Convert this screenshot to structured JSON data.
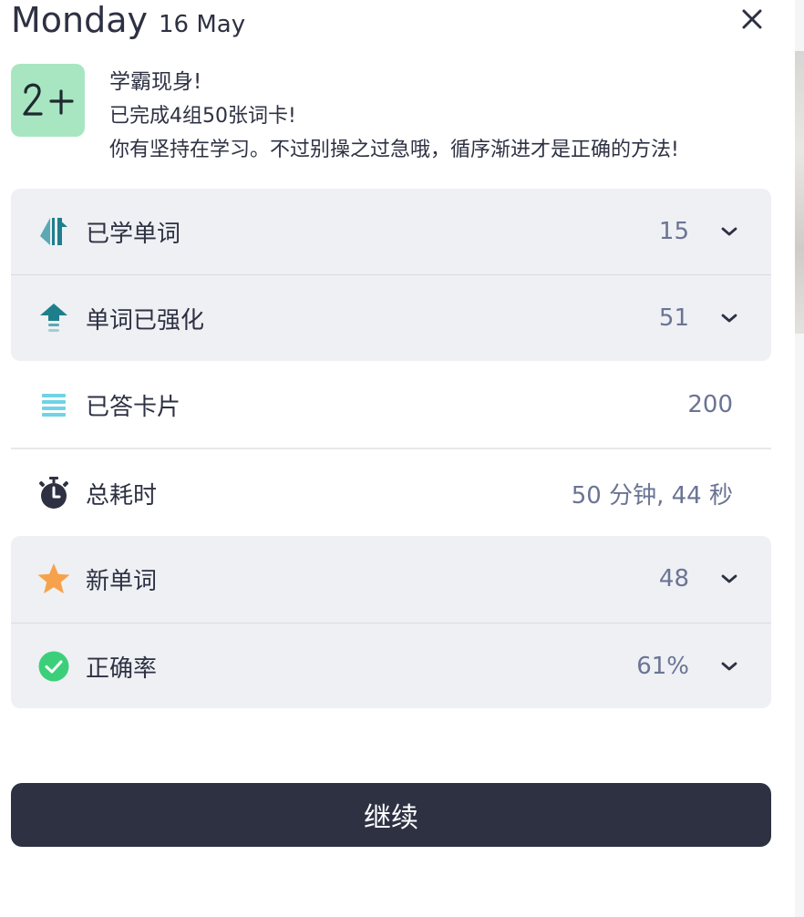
{
  "header": {
    "day": "Monday",
    "date": "16 May"
  },
  "achievement": {
    "badge_text": "2+",
    "title": "学霸现身!",
    "line1": "已完成4组50张词卡!",
    "line2": "你有坚持在学习。不过别操之过急哦，循序渐进才是正确的方法!"
  },
  "stats": {
    "learned": {
      "label": "已学单词",
      "value": "15",
      "icon": "arrows-updown-icon"
    },
    "strengthened": {
      "label": "单词已强化",
      "value": "51",
      "icon": "arrow-up-stack-icon"
    },
    "cards": {
      "label": "已答卡片",
      "value": "200",
      "icon": "list-lines-icon"
    },
    "time": {
      "label": "总耗时",
      "value": "50 分钟, 44 秒",
      "icon": "stopwatch-icon"
    },
    "new_words": {
      "label": "新单词",
      "value": "48",
      "icon": "star-icon"
    },
    "accuracy": {
      "label": "正确率",
      "value": "61%",
      "icon": "check-circle-icon"
    }
  },
  "continue_button": {
    "label": "继续"
  },
  "colors": {
    "dark": "#2d3142",
    "panel": "#eef0f4",
    "badge": "#a8e6c2",
    "teal": "#1e7f8c",
    "star": "#f6a24c",
    "check": "#3ccf7a",
    "value": "#6b7494"
  }
}
